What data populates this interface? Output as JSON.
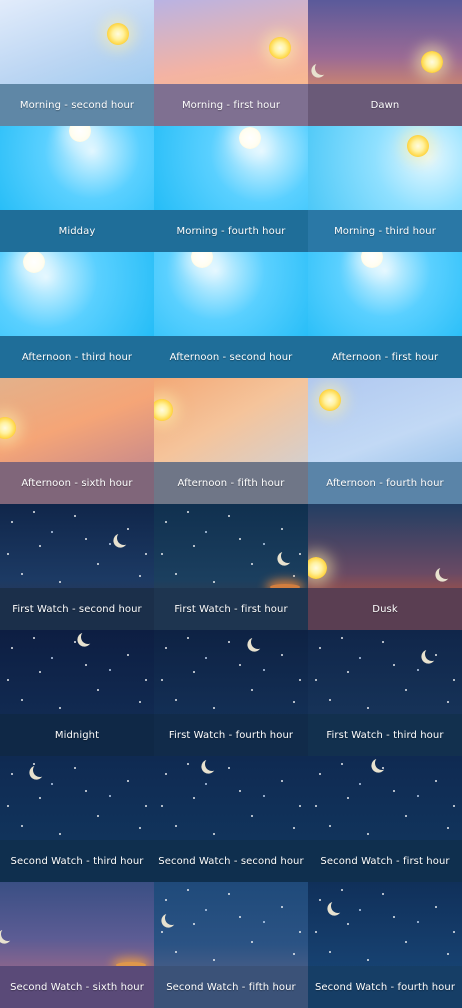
{
  "tiles": [
    {
      "label": "Morning - second hour",
      "theme": "morning2"
    },
    {
      "label": "Morning - first hour",
      "theme": "morning1"
    },
    {
      "label": "Dawn",
      "theme": "dawn"
    },
    {
      "label": "Midday",
      "theme": "midday"
    },
    {
      "label": "Morning - fourth hour",
      "theme": "morning4"
    },
    {
      "label": "Morning - third hour",
      "theme": "morning3"
    },
    {
      "label": "Afternoon - third hour",
      "theme": "afternoon3"
    },
    {
      "label": "Afternoon - second hour",
      "theme": "afternoon2"
    },
    {
      "label": "Afternoon - first hour",
      "theme": "afternoon1"
    },
    {
      "label": "Afternoon - sixth hour",
      "theme": "afternoon6"
    },
    {
      "label": "Afternoon - fifth hour",
      "theme": "afternoon5"
    },
    {
      "label": "Afternoon - fourth hour",
      "theme": "afternoon4"
    },
    {
      "label": "First Watch - second hour",
      "theme": "fw2"
    },
    {
      "label": "First Watch - first hour",
      "theme": "fw1"
    },
    {
      "label": "Dusk",
      "theme": "dusk"
    },
    {
      "label": "Midnight",
      "theme": "midnight"
    },
    {
      "label": "First Watch - fourth hour",
      "theme": "fw4"
    },
    {
      "label": "First Watch - third hour",
      "theme": "fw3"
    },
    {
      "label": "Second Watch - third hour",
      "theme": "sw3"
    },
    {
      "label": "Second Watch - second hour",
      "theme": "sw2"
    },
    {
      "label": "Second Watch - first hour",
      "theme": "sw1"
    },
    {
      "label": "Second Watch - sixth hour",
      "theme": "sw6"
    },
    {
      "label": "Second Watch - fifth hour",
      "theme": "sw5"
    },
    {
      "label": "Second Watch - fourth hour",
      "theme": "sw4"
    }
  ]
}
